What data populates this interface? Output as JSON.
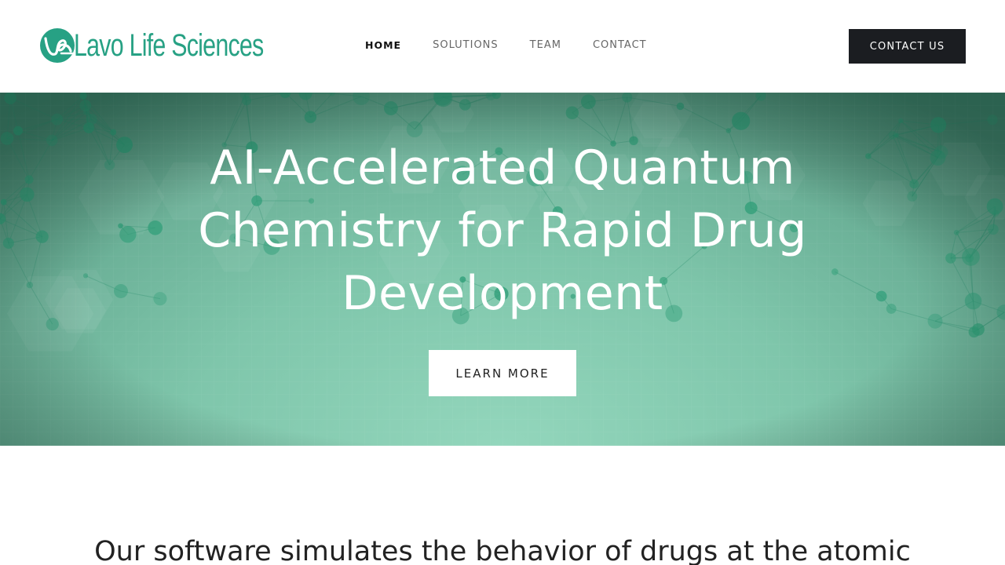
{
  "brand": {
    "name": "Lavo Life Sciences",
    "color": "#27a184"
  },
  "nav": {
    "items": [
      {
        "label": "HOME",
        "active": true
      },
      {
        "label": "SOLUTIONS",
        "active": false
      },
      {
        "label": "TEAM",
        "active": false
      },
      {
        "label": "CONTACT",
        "active": false
      }
    ],
    "cta_label": "CONTACT US"
  },
  "hero": {
    "title_lines": [
      "AI-Accelerated Quantum",
      "Chemistry for Rapid Drug",
      "Development"
    ],
    "button_label": "LEARN MORE",
    "background_color": "#7fc6ab"
  },
  "intro": {
    "text": "Our software simulates the behavior of drugs at the atomic"
  },
  "icons": [
    "logo-mark-icon",
    "molecule-network-background"
  ]
}
